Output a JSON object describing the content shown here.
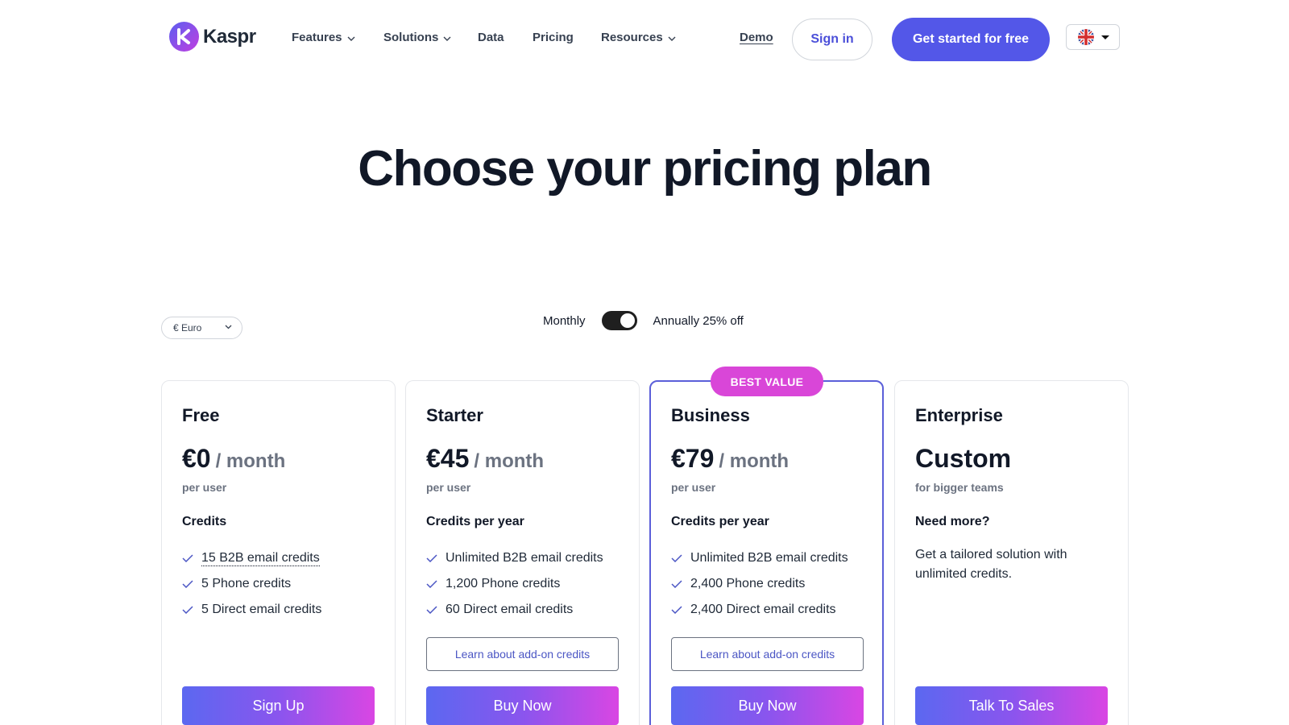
{
  "brand": {
    "name": "Kaspr"
  },
  "nav": {
    "items": [
      {
        "label": "Features",
        "has_dropdown": true
      },
      {
        "label": "Solutions",
        "has_dropdown": true
      },
      {
        "label": "Data",
        "has_dropdown": false
      },
      {
        "label": "Pricing",
        "has_dropdown": false
      },
      {
        "label": "Resources",
        "has_dropdown": true
      }
    ],
    "demo": "Demo",
    "signin": "Sign in",
    "cta": "Get started for free",
    "language_icon": "uk-flag-icon"
  },
  "hero": {
    "title": "Choose your pricing plan"
  },
  "controls": {
    "currency": "€ Euro",
    "billing_monthly": "Monthly",
    "billing_annual": "Annually 25% off",
    "annual_selected": true
  },
  "badge": "BEST VALUE",
  "plans": [
    {
      "name": "Free",
      "price": "€0",
      "period": "/ month",
      "sub": "per user",
      "credits_heading": "Credits",
      "features": [
        "15 B2B email credits",
        "5 Phone credits",
        "5 Direct email credits"
      ],
      "button": "Sign Up"
    },
    {
      "name": "Starter",
      "price": "€45",
      "period": "/ month",
      "sub": "per user",
      "credits_heading": "Credits per year",
      "features": [
        "Unlimited B2B email credits",
        "1,200 Phone credits",
        "60 Direct email credits"
      ],
      "addon": "Learn about add-on credits",
      "button": "Buy Now"
    },
    {
      "name": "Business",
      "price": "€79",
      "period": "/ month",
      "sub": "per user",
      "credits_heading": "Credits per year",
      "features": [
        "Unlimited B2B email credits",
        "2,400 Phone credits",
        "2,400 Direct email credits"
      ],
      "addon": "Learn about add-on credits",
      "button": "Buy Now"
    },
    {
      "name": "Enterprise",
      "price": "Custom",
      "sub": "for bigger teams",
      "credits_heading": "Need more?",
      "description": "Get a tailored solution with unlimited credits.",
      "button": "Talk To Sales"
    }
  ],
  "colors": {
    "primary": "#5357e8",
    "badge": "#d946d8",
    "gradient_start": "#5b68f0",
    "gradient_end": "#d946e3",
    "check": "#4b56c4"
  }
}
